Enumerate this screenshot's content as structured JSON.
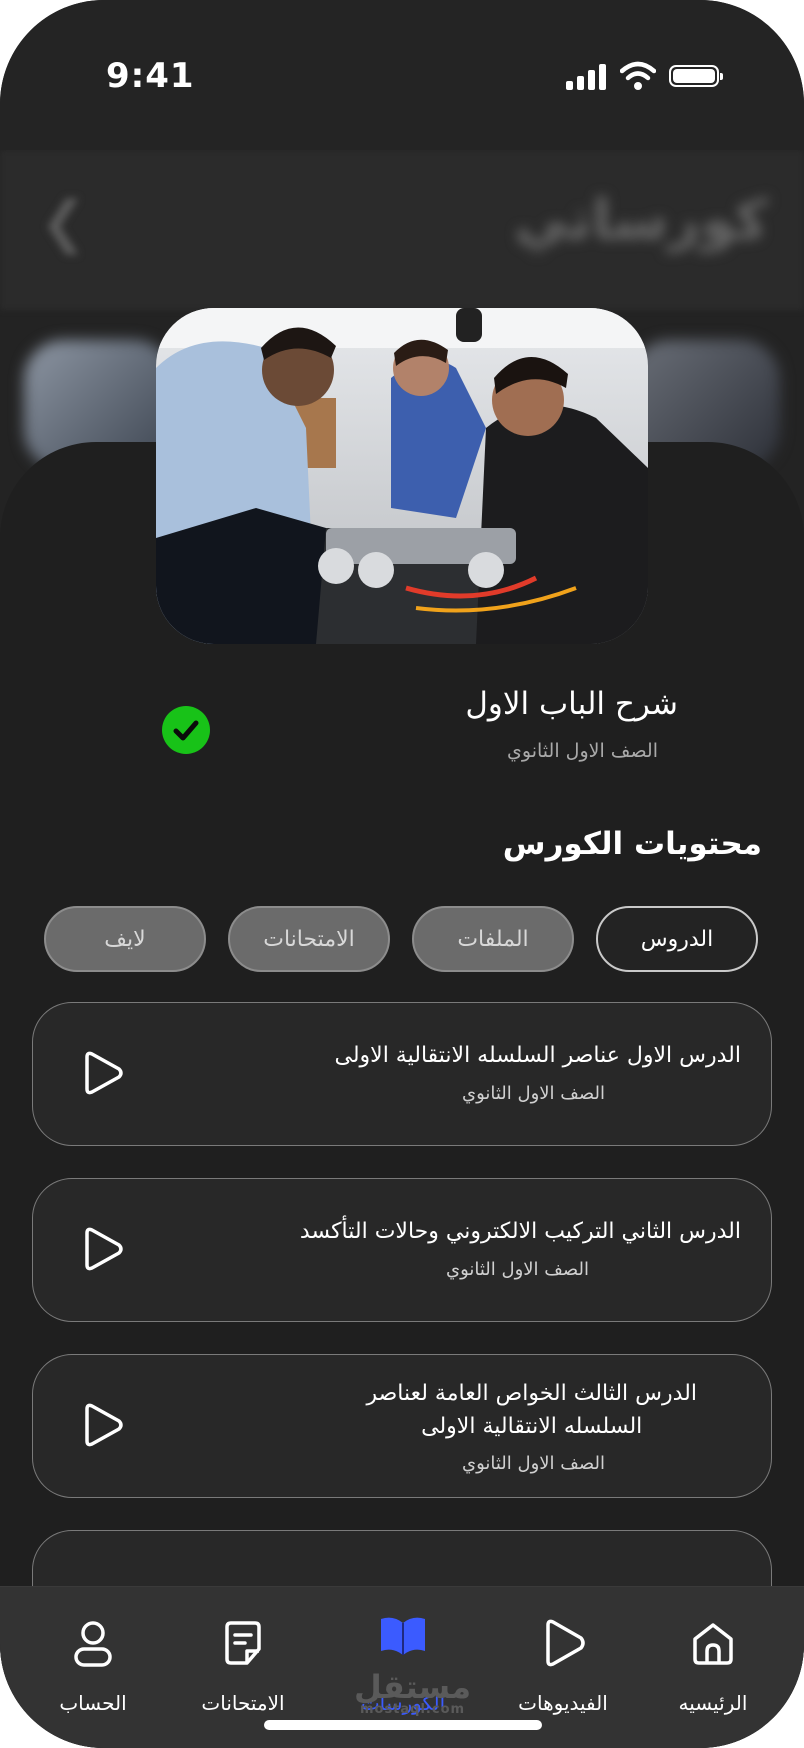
{
  "status_bar": {
    "time": "9:41"
  },
  "header": {
    "back_icon": "chevron-left-icon",
    "blurred_title": "كورساتي"
  },
  "chapter": {
    "title": "شرح الباب الاول",
    "subtitle": "الصف الاول الثانوي",
    "completed": true
  },
  "section": {
    "title": "محتويات الكورس"
  },
  "tabs": [
    {
      "label": "الدروس",
      "active": true
    },
    {
      "label": "الملفات",
      "active": false
    },
    {
      "label": "الامتحانات",
      "active": false
    },
    {
      "label": "لايف",
      "active": false
    }
  ],
  "lessons": [
    {
      "title_line1": "الدرس الاول عناصر السلسله الانتقالية الاولى",
      "title_line2": "",
      "subtitle": "الصف الاول الثانوي"
    },
    {
      "title_line1": "الدرس الثاني التركيب الالكتروني وحالات التأكسد",
      "title_line2": "",
      "subtitle": "الصف الاول الثانوي"
    },
    {
      "title_line1": "الدرس الثالث الخواص العامة لعناصر",
      "title_line2": "السلسله الانتقالية الاولى",
      "subtitle": "الصف الاول الثانوي"
    }
  ],
  "bottom_nav": [
    {
      "label": "الرئيسيه",
      "icon": "home-icon",
      "active": false
    },
    {
      "label": "الفيديوهات",
      "icon": "play-icon",
      "active": false
    },
    {
      "label": "الكورسات",
      "icon": "book-icon",
      "active": true
    },
    {
      "label": "الامتحانات",
      "icon": "exam-note-icon",
      "active": false
    },
    {
      "label": "الحساب",
      "icon": "user-icon",
      "active": false
    }
  ],
  "watermark": {
    "text": "مستقل",
    "domain": "mostaql.com"
  },
  "colors": {
    "background": "#1f1f1f",
    "accent": "#3b5bff",
    "success": "#18c218"
  }
}
